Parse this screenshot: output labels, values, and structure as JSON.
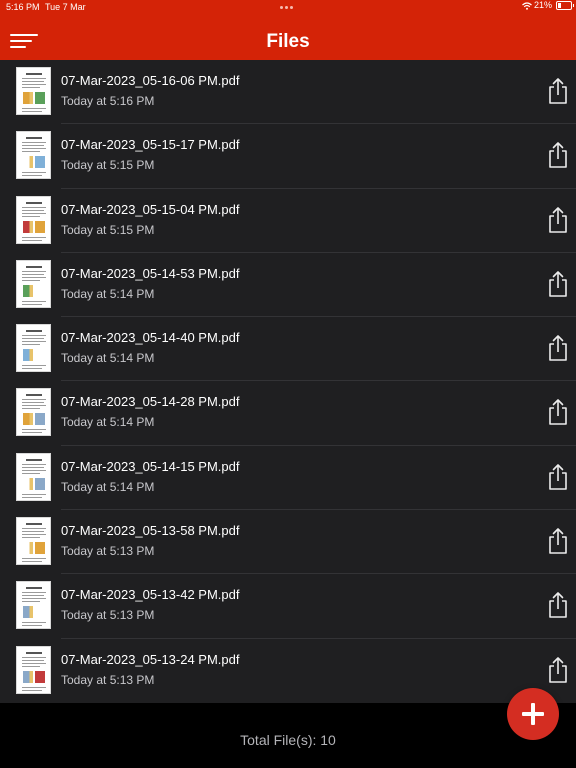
{
  "status_bar": {
    "time": "5:16 PM",
    "date": "Tue 7 Mar",
    "battery": "21%"
  },
  "header": {
    "title": "Files",
    "menu_icon": "hamburger-menu-icon"
  },
  "colors": {
    "brand": "#d42307",
    "list_background": "#1f1f21",
    "add_button": "#d42d22"
  },
  "files": [
    {
      "name": "07-Mar-2023_05-16-06 PM.pdf",
      "time": "Today at 5:16 PM"
    },
    {
      "name": "07-Mar-2023_05-15-17 PM.pdf",
      "time": "Today at 5:15 PM"
    },
    {
      "name": "07-Mar-2023_05-15-04 PM.pdf",
      "time": "Today at 5:15 PM"
    },
    {
      "name": "07-Mar-2023_05-14-53 PM.pdf",
      "time": "Today at 5:14 PM"
    },
    {
      "name": "07-Mar-2023_05-14-40 PM.pdf",
      "time": "Today at 5:14 PM"
    },
    {
      "name": "07-Mar-2023_05-14-28 PM.pdf",
      "time": "Today at 5:14 PM"
    },
    {
      "name": "07-Mar-2023_05-14-15 PM.pdf",
      "time": "Today at 5:14 PM"
    },
    {
      "name": "07-Mar-2023_05-13-58 PM.pdf",
      "time": "Today at 5:13 PM"
    },
    {
      "name": "07-Mar-2023_05-13-42 PM.pdf",
      "time": "Today at 5:13 PM"
    },
    {
      "name": "07-Mar-2023_05-13-24 PM.pdf",
      "time": "Today at 5:13 PM"
    }
  ],
  "footer": {
    "total_label": "Total File(s): 10"
  }
}
